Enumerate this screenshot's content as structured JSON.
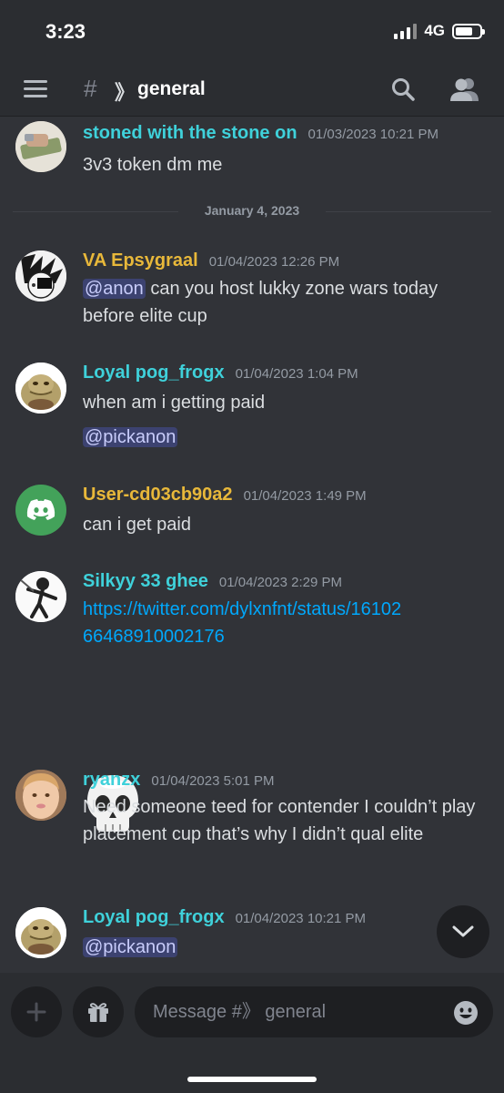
{
  "status_bar": {
    "time": "3:23",
    "network": "4G"
  },
  "header": {
    "channel_name": "general"
  },
  "date_divider": "January 4, 2023",
  "messages": [
    {
      "username": "stoned with the stone on",
      "timestamp": "01/03/2023 10:21 PM",
      "text": "3v3 token dm me",
      "color": "#3fd1da"
    },
    {
      "username": "VA Epsygraal",
      "timestamp": "01/04/2023 12:26 PM",
      "mention": "@anon",
      "text": " can you host lukky zone wars today before elite cup",
      "color": "#e8b83a"
    },
    {
      "username": "Loyal pog_frogx",
      "timestamp": "01/04/2023 1:04 PM",
      "text": "when am i getting paid",
      "mention": "@pickanon",
      "color": "#3fd1da"
    },
    {
      "username": "User-cd03cb90a2",
      "timestamp": "01/04/2023 1:49 PM",
      "text": "can i get paid",
      "color": "#e8b83a"
    },
    {
      "username": "Silkyy 33 ghee",
      "timestamp": "01/04/2023 2:29 PM",
      "link": "https://twitter.com/dylxnfnt/status/1610266468910002176",
      "emoji": "skull",
      "color": "#3fd1da"
    },
    {
      "username": "ryanzx",
      "timestamp": "01/04/2023 5:01 PM",
      "text": "Need someone teed for contender I couldn’t play placement cup that’s why I didn’t qual elite",
      "color": "#3fd1da"
    },
    {
      "username": "Loyal pog_frogx",
      "timestamp": "01/04/2023 10:21 PM",
      "mention": "@pickanon",
      "color": "#3fd1da"
    }
  ],
  "composer": {
    "placeholder": "Message #》 general"
  }
}
